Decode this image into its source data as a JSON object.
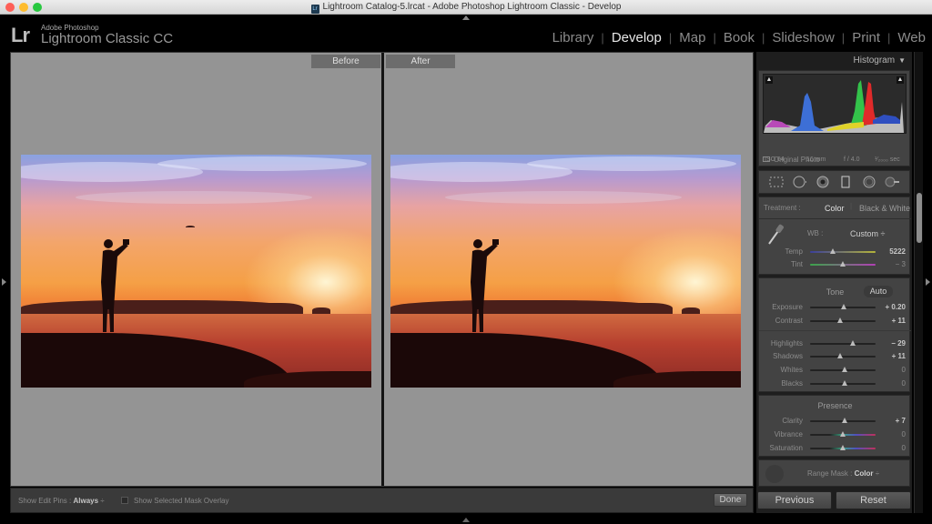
{
  "window": {
    "title": "Lightroom Catalog-5.lrcat - Adobe Photoshop Lightroom Classic - Develop",
    "doc_icon": "Lr"
  },
  "identity_plate": {
    "logo": "Lr",
    "subtitle": "Adobe Photoshop",
    "product": "Lightroom Classic CC"
  },
  "modules": [
    {
      "label": "Library",
      "active": false
    },
    {
      "label": "Develop",
      "active": true
    },
    {
      "label": "Map",
      "active": false
    },
    {
      "label": "Book",
      "active": false
    },
    {
      "label": "Slideshow",
      "active": false
    },
    {
      "label": "Print",
      "active": false
    },
    {
      "label": "Web",
      "active": false
    }
  ],
  "viewer": {
    "before_label": "Before",
    "after_label": "After"
  },
  "toolbar": {
    "edit_pins_label": "Show Edit Pins :",
    "edit_pins_value": "Always",
    "edit_pins_arrows": "÷",
    "mask_overlay_label": "Show Selected Mask Overlay",
    "mask_overlay_checked": false,
    "done_label": "Done"
  },
  "histogram": {
    "title": "Histogram",
    "collapse_icon": "▼",
    "iso": "ISO 64",
    "focal": "16 mm",
    "aperture": "f / 4.0",
    "shutter": "¹⁄₂₀₀₀ sec",
    "original_photo_label": "Original Photo",
    "clip_shadow_icon": "▲",
    "clip_highlight_icon": "▲"
  },
  "tools": [
    "crop-overlay",
    "spot-removal",
    "red-eye",
    "graduated-filter",
    "radial-filter",
    "adjustment-brush"
  ],
  "basic": {
    "treatment_label": "Treatment :",
    "treatment_options": [
      "Color",
      "Black & White"
    ],
    "treatment_selected": "Color",
    "wb_label": "WB :",
    "wb_value": "Custom",
    "wb_arrows": "÷",
    "tone_label": "Tone",
    "auto_label": "Auto",
    "presence_label": "Presence",
    "sliders": {
      "temp": {
        "label": "Temp",
        "value": "5222",
        "position": 0.35
      },
      "tint": {
        "label": "Tint",
        "value": "− 3",
        "position": 0.5
      },
      "exposure": {
        "label": "Exposure",
        "value": "+ 0.20",
        "position": 0.51
      },
      "contrast": {
        "label": "Contrast",
        "value": "+ 11",
        "position": 0.46
      },
      "highlights": {
        "label": "Highlights",
        "value": "− 29",
        "position": 0.65
      },
      "shadows": {
        "label": "Shadows",
        "value": "+ 11",
        "position": 0.46
      },
      "whites": {
        "label": "Whites",
        "value": "0",
        "position": 0.53
      },
      "blacks": {
        "label": "Blacks",
        "value": "0",
        "position": 0.53
      },
      "clarity": {
        "label": "Clarity",
        "value": "+ 7",
        "position": 0.53
      },
      "vibrance": {
        "label": "Vibrance",
        "value": "0",
        "position": 0.5
      },
      "saturation": {
        "label": "Saturation",
        "value": "0",
        "position": 0.5
      }
    }
  },
  "range_mask": {
    "label": "Range Mask :",
    "value": "Color",
    "arrows": "÷"
  },
  "bottom_buttons": {
    "previous": "Previous",
    "reset": "Reset"
  }
}
